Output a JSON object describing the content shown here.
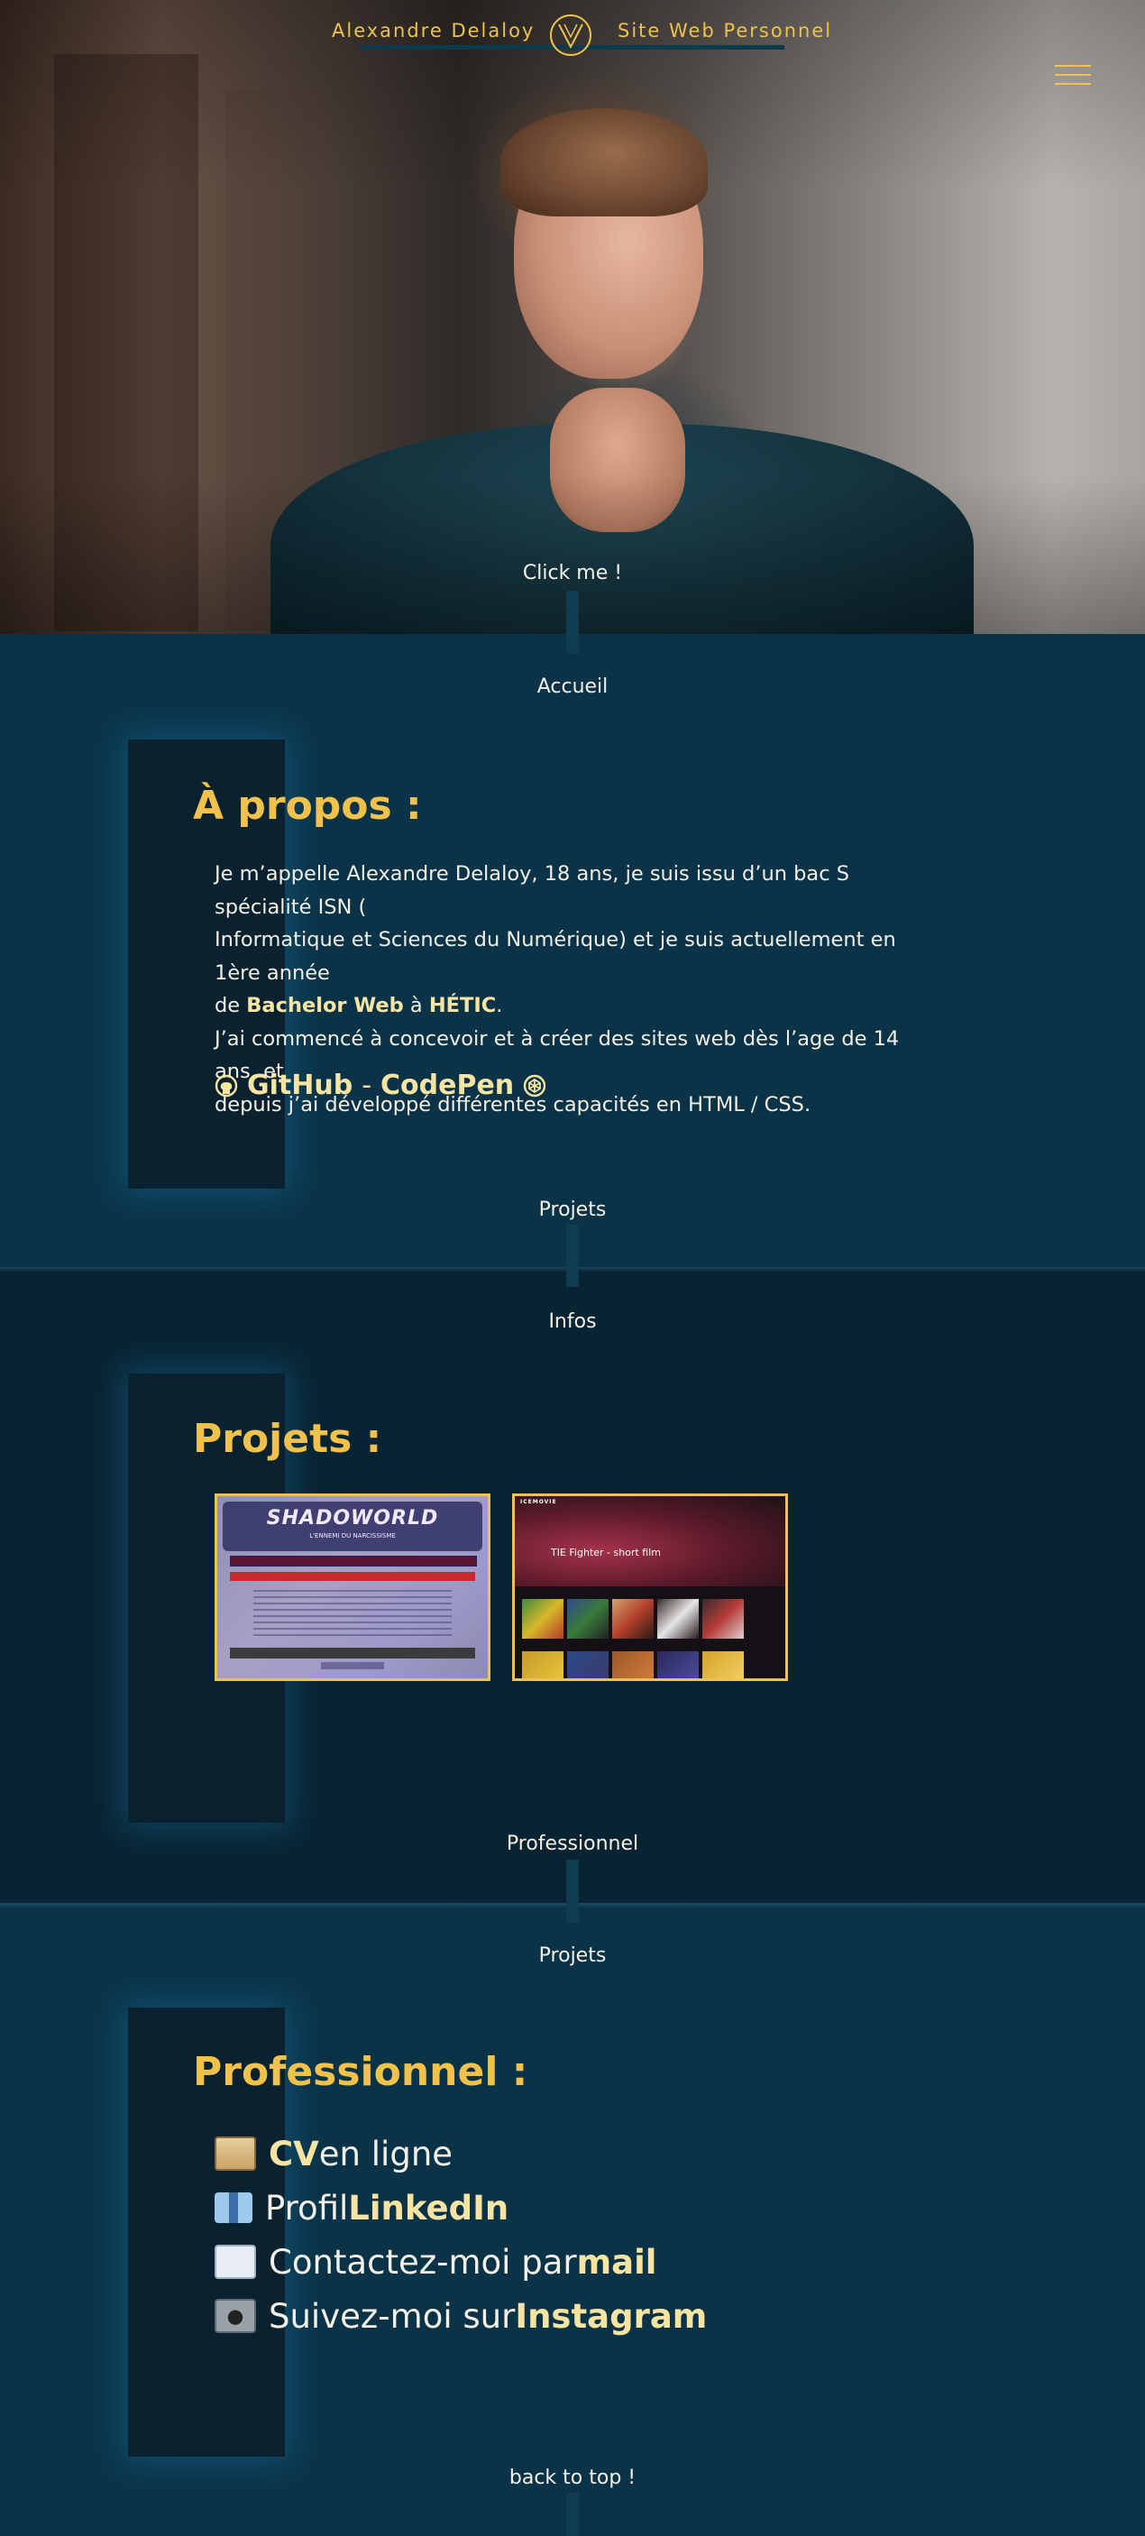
{
  "header": {
    "name": "Alexandre Delaloy",
    "site": "Site Web Personnel",
    "click_me": "Click me !"
  },
  "nav_links": {
    "accueil": "Accueil",
    "projets_1": "Projets",
    "infos": "Infos",
    "professionnel": "Professionnel",
    "projets_2": "Projets",
    "back_to_top": "back to top !"
  },
  "about": {
    "title": "À propos :",
    "p1_a": "Je m’appelle Alexandre Delaloy, 18 ans, je suis issu d’un bac S spécialité ISN (",
    "p1_b": "Informatique et Sciences du Numérique) et je suis actuellement en 1ère année",
    "p1_c_pre": "de ",
    "p1_c_hl1": "Bachelor Web",
    "p1_c_mid": " à ",
    "p1_c_hl2": "HÉTIC",
    "p1_c_post": ".",
    "p2_a": "J’ai commencé à concevoir et à créer des sites web dès l’age de 14 ans, et",
    "p2_b": "depuis j’ai développé différentes capacités en HTML / CSS.",
    "github": "GitHub",
    "dash": "-",
    "codepen": "CodePen"
  },
  "projects": {
    "title": "Projets :",
    "items": [
      {
        "logo_text": "SHADOWORLD",
        "logo_sub": "L'ENNEMI DU NARCISSISME"
      },
      {
        "brand": "ICEMOVIE",
        "headline": "TIE Fighter - short film"
      }
    ]
  },
  "professional": {
    "title": "Professionnel :",
    "items": [
      {
        "icon": "scroll-icon",
        "pre": "",
        "hl": "CV",
        "post": " en ligne"
      },
      {
        "icon": "necktie-icon",
        "pre": "Profil ",
        "hl": "LinkedIn",
        "post": ""
      },
      {
        "icon": "envelope-icon",
        "pre": "Contactez-moi par ",
        "hl": "mail",
        "post": ""
      },
      {
        "icon": "camera-icon",
        "pre": "Suivez-moi sur ",
        "hl": "Instagram",
        "post": ""
      }
    ]
  },
  "colors": {
    "accent": "#f0c14b",
    "section_bg": "#0a3347",
    "section_bg_dark": "#082331"
  }
}
